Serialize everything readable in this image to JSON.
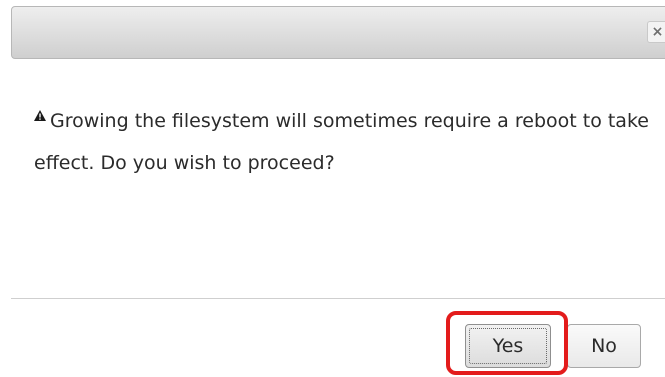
{
  "dialog": {
    "close_label": "×",
    "warning_icon": "warning-triangle-icon",
    "message": "Growing the filesystem will sometimes require a reboot to take effect. Do you wish to proceed?",
    "buttons": {
      "yes_label": "Yes",
      "no_label": "No"
    },
    "highlight_color": "#e31b1b"
  }
}
